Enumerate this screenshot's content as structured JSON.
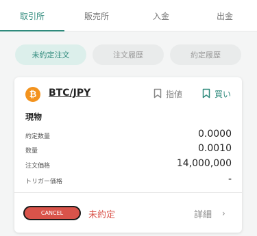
{
  "tabs": [
    {
      "label": "取引所"
    },
    {
      "label": "販売所"
    },
    {
      "label": "入金"
    },
    {
      "label": "出金"
    }
  ],
  "subtabs": [
    {
      "label": "未約定注文"
    },
    {
      "label": "注文履歴"
    },
    {
      "label": "約定履歴"
    }
  ],
  "order": {
    "coin_symbol": "₿",
    "pair": "BTC/JPY",
    "limit_label": "指値",
    "side_label": "買い",
    "kind": "現物",
    "rows": [
      {
        "label": "約定数量",
        "value": "0.0000"
      },
      {
        "label": "数量",
        "value": "0.0010"
      },
      {
        "label": "注文価格",
        "value": "14,000,000"
      },
      {
        "label": "トリガー価格",
        "value": "-"
      }
    ],
    "cancel_label": "CANCEL",
    "status": "未約定",
    "detail_label": "詳細",
    "chevron": "›"
  },
  "colors": {
    "accent": "#2f8a7c",
    "cancel": "#d9534a",
    "btc": "#f3931e"
  }
}
